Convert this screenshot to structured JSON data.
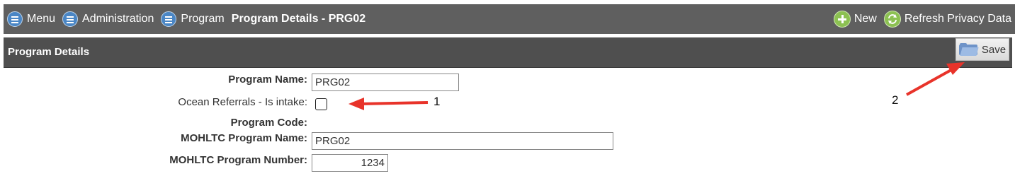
{
  "breadcrumbs": [
    {
      "label": "Menu"
    },
    {
      "label": "Administration"
    },
    {
      "label": "Program"
    }
  ],
  "page_title": "Program Details - PRG02",
  "toolbar": {
    "new_label": "New",
    "refresh_label": "Refresh Privacy Data",
    "new_icon": "plus-icon",
    "refresh_icon": "refresh-icon"
  },
  "section": {
    "title": "Program Details",
    "save_label": "Save",
    "save_icon": "folder-icon"
  },
  "form": {
    "program_name": {
      "label": "Program Name:",
      "value": "PRG02"
    },
    "ocean_referrals": {
      "label": "Ocean Referrals - Is intake:",
      "checked": false
    },
    "program_code": {
      "label": "Program Code:",
      "value": ""
    },
    "mohltc_program_name": {
      "label": "MOHLTC Program Name:",
      "value": "PRG02"
    },
    "mohltc_program_number": {
      "label": "MOHLTC Program Number:",
      "value": "1234"
    }
  },
  "annotations": {
    "one": "1",
    "two": "2",
    "arrow_color": "#e8332a"
  },
  "colors": {
    "topbar": "#5f5f5f",
    "section_bar": "#4f4f4f",
    "menu_icon": "#4a86c5",
    "action_icon": "#8cc152"
  }
}
